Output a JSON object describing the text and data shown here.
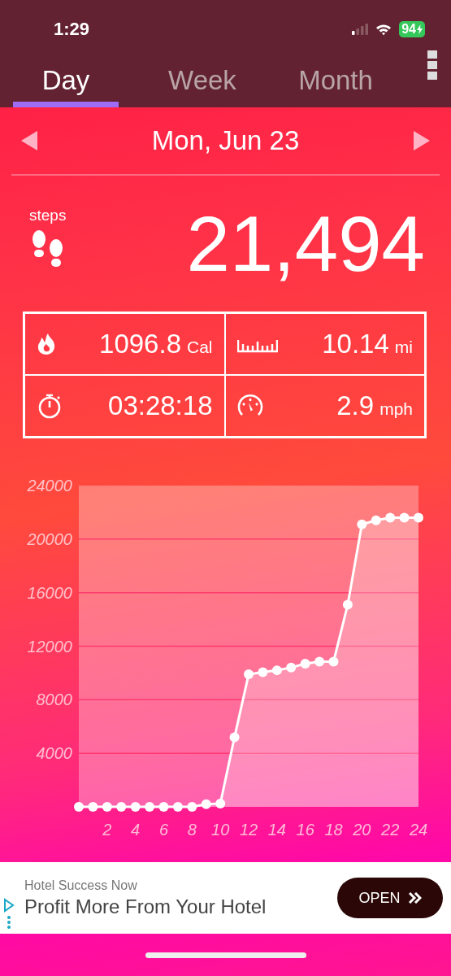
{
  "status_bar": {
    "time": "1:29",
    "battery": "94"
  },
  "tabs": [
    {
      "label": "Day",
      "selected": true
    },
    {
      "label": "Week",
      "selected": false
    },
    {
      "label": "Month",
      "selected": false
    }
  ],
  "date": "Mon, Jun 23",
  "steps": {
    "label": "steps",
    "value": "21,494"
  },
  "stats": [
    {
      "kind": "calories",
      "value": "1096.8",
      "unit": "Cal"
    },
    {
      "kind": "distance",
      "value": "10.14",
      "unit": "mi"
    },
    {
      "kind": "duration",
      "value": "03:28:18"
    },
    {
      "kind": "speed",
      "value": "2.9",
      "unit": "mph"
    }
  ],
  "chart_data": {
    "type": "area",
    "x": [
      0,
      1,
      2,
      3,
      4,
      5,
      6,
      7,
      8,
      9,
      10,
      11,
      12,
      13,
      14,
      15,
      16,
      17,
      18,
      19,
      20,
      21,
      22,
      23,
      24
    ],
    "series": [
      {
        "color": "#ffffff",
        "values": [
          0,
          0,
          0,
          0,
          0,
          0,
          0,
          0,
          0,
          200,
          250,
          5200,
          9900,
          10050,
          10200,
          10400,
          10700,
          10850,
          10850,
          15100,
          21100,
          21400,
          21600,
          21600,
          21600
        ]
      }
    ],
    "xlim": [
      0,
      24
    ],
    "ylim": [
      0,
      24000
    ],
    "xticks": [
      2,
      4,
      6,
      8,
      10,
      12,
      14,
      16,
      18,
      20,
      22,
      24
    ],
    "yticks": [
      4000,
      8000,
      12000,
      16000,
      20000,
      24000
    ],
    "grid": true
  },
  "ad": {
    "advertiser": "Hotel Success Now",
    "headline": "Profit More From Your Hotel",
    "button": "OPEN"
  }
}
